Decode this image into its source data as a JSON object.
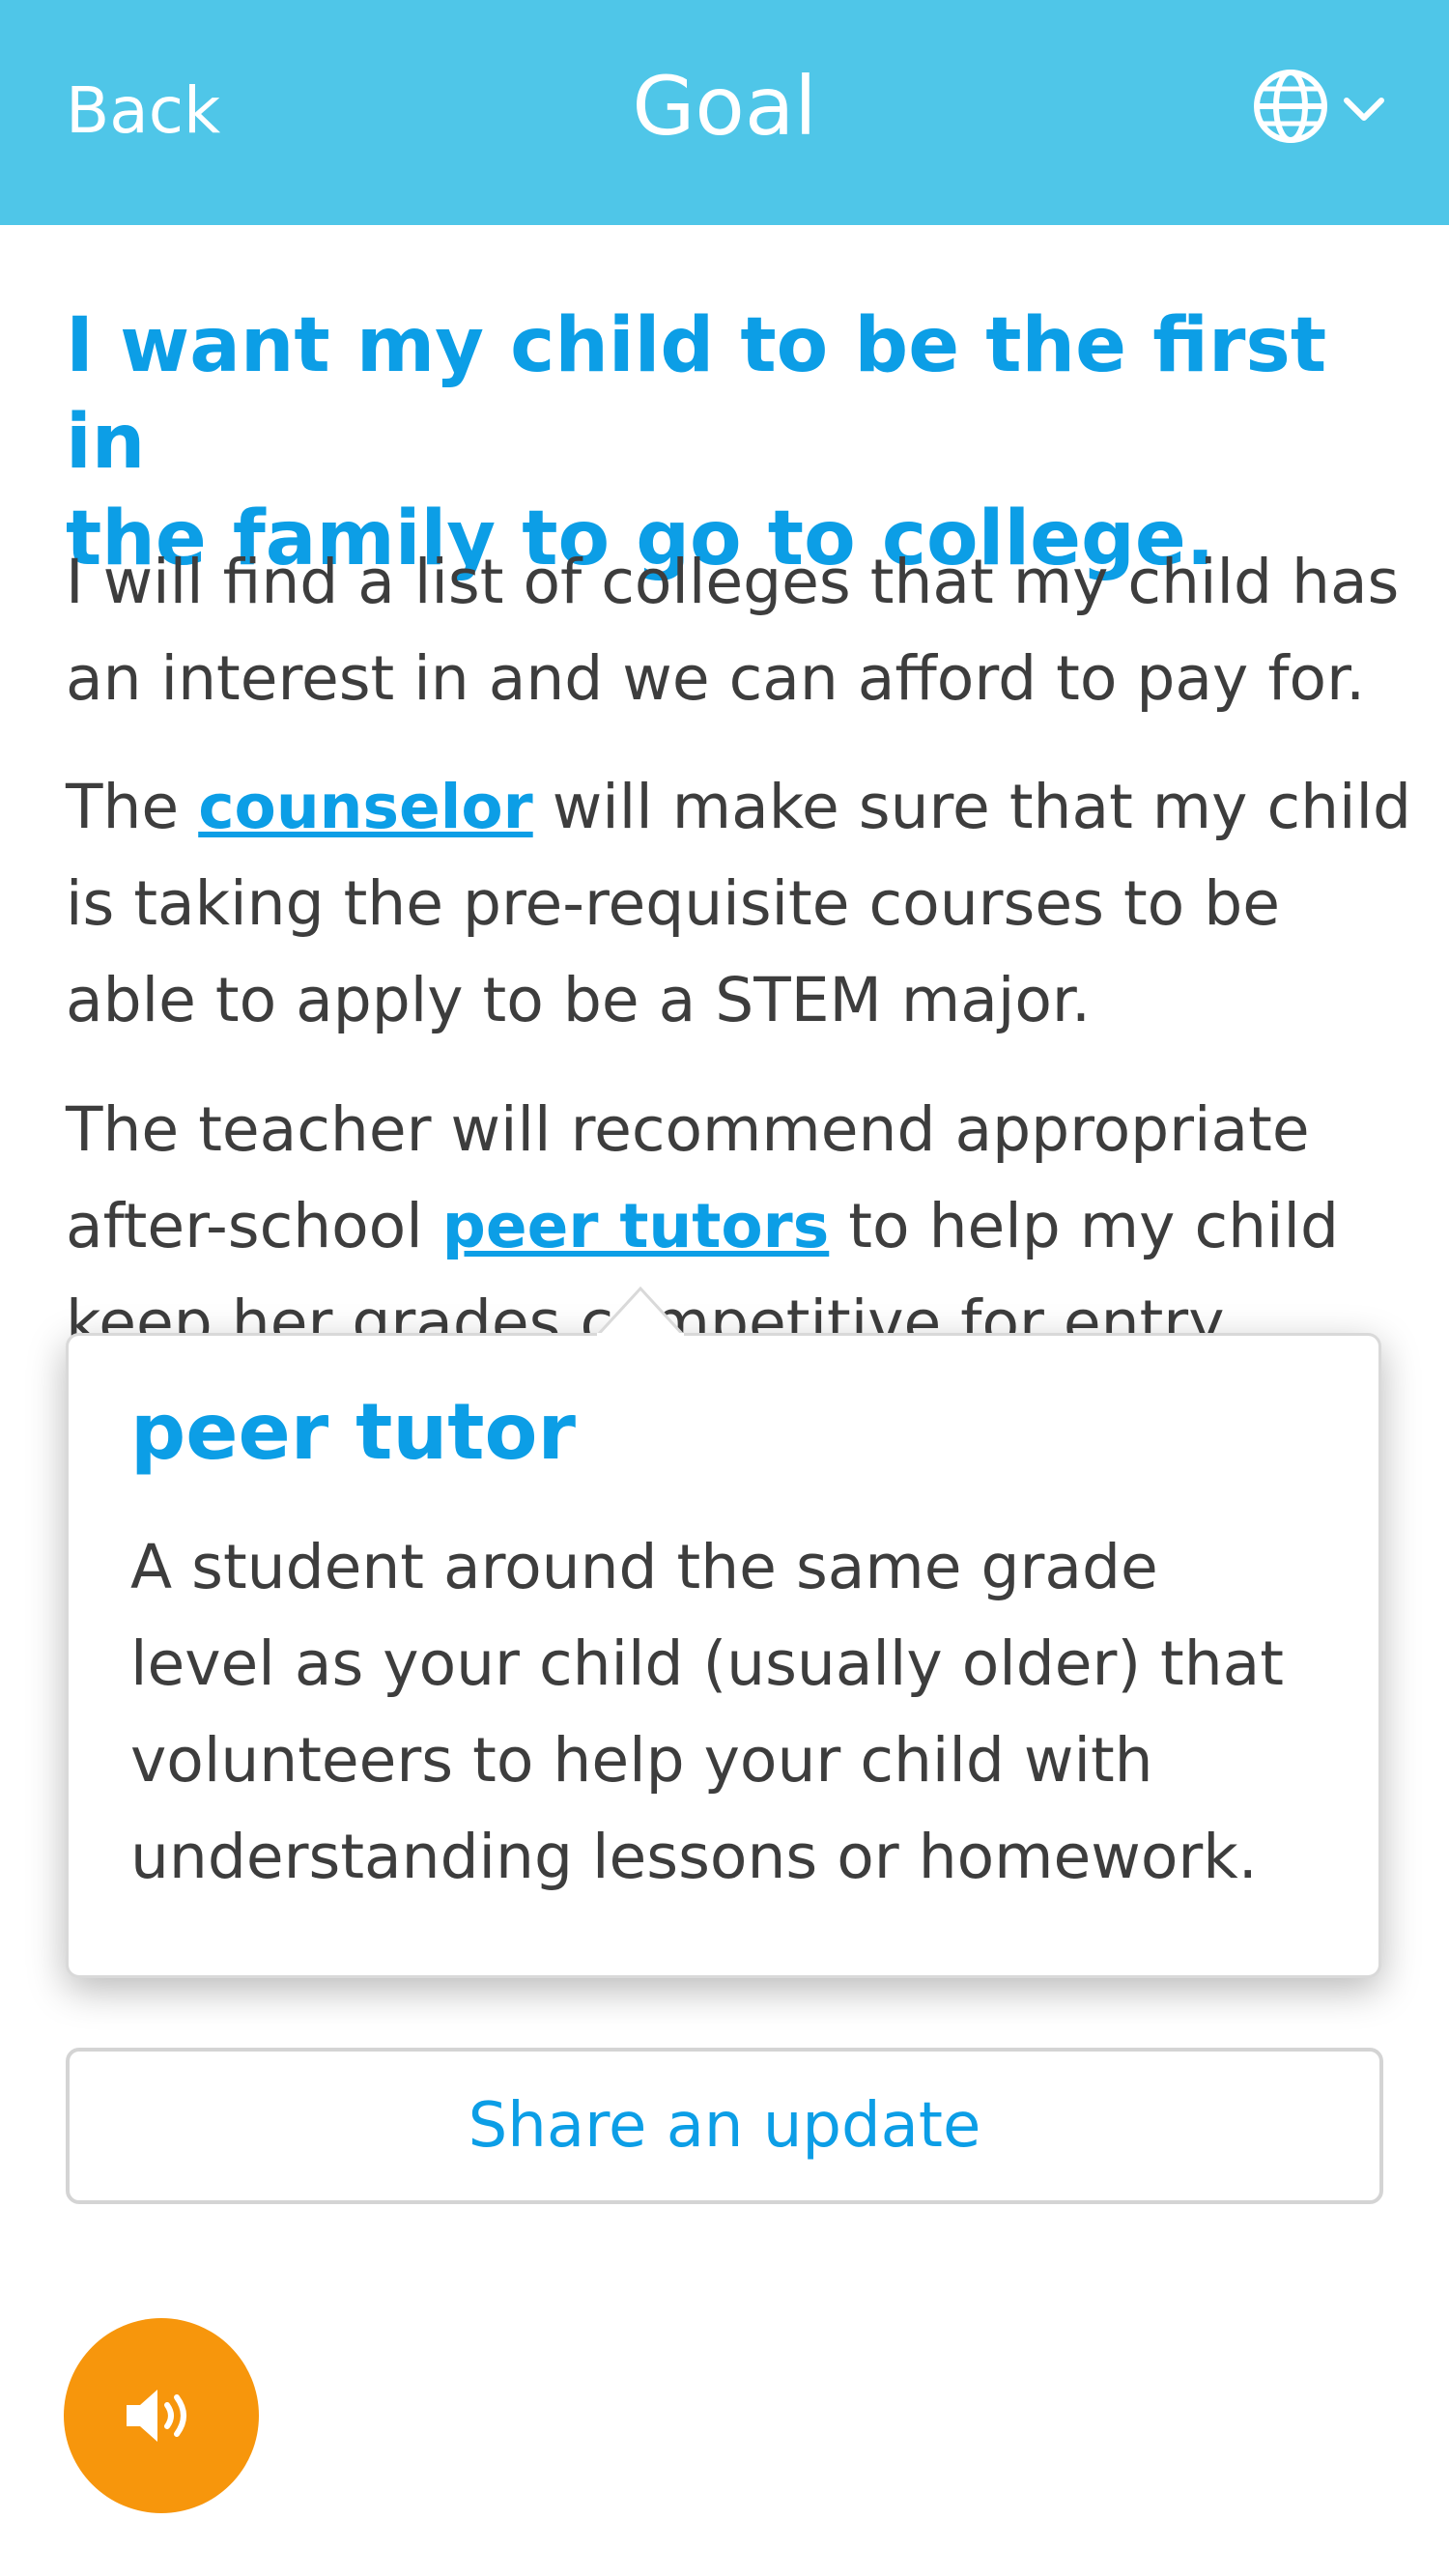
{
  "header": {
    "back_label": "Back",
    "title": "Goal",
    "language_icon": "globe-icon",
    "dropdown_icon": "chevron-down-icon",
    "background_color": "#4fc6e8"
  },
  "goal": {
    "headline_line1": "I want my child to be the first in",
    "headline_line2": "the family to go to college.",
    "para1_line1": "I will find a list of colleges that my child has",
    "para1_line2": "an interest in and we can afford to pay for.",
    "para2_prefix": "The ",
    "para2_link": "counselor",
    "para2_line1_suffix": " will make sure that my child",
    "para2_line2": "is taking the pre-requisite courses to be",
    "para2_line3": "able to apply to be a STEM major.",
    "para3_line1": "The teacher will recommend appropriate",
    "para3_line2_prefix": "after-school ",
    "para3_link": "peer tutors",
    "para3_line2_suffix": " to help my child",
    "para3_line3": "keep her grades competitive for entry"
  },
  "glossary_popover": {
    "term": "peer tutor",
    "definition_line1": "A student around the same grade",
    "definition_line2": "level as your child (usually older) that",
    "definition_line3": "volunteers to help your child with",
    "definition_line4": "understanding lessons or homework."
  },
  "actions": {
    "share_label": "Share an update",
    "audio_icon": "speaker-icon"
  },
  "colors": {
    "accent": "#0c9ee6",
    "audio_button": "#f7960c",
    "body_text": "#3d3d3d"
  }
}
